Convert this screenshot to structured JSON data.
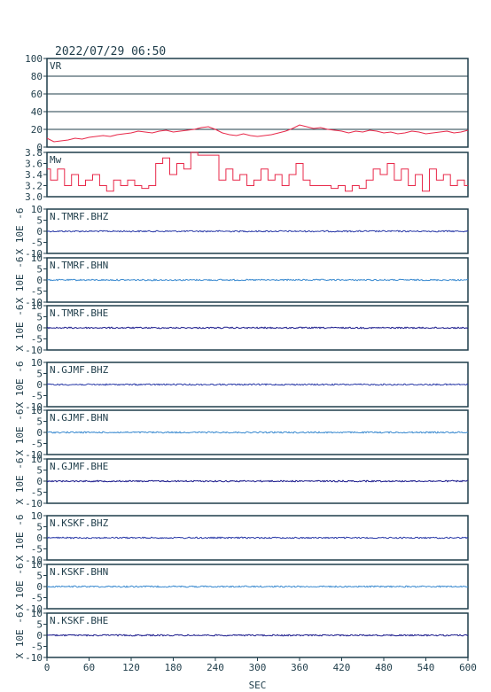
{
  "header": {
    "datetime": "2022/07/29  06:50"
  },
  "colors": {
    "vr_line": "#e8294a",
    "mw_line": "#e8294a",
    "trace_dark": "#1a1a8c",
    "trace_mid": "#2a3aa8",
    "trace_light": "#3a8ad0",
    "frame": "#1f3d4a",
    "grid": "#1f3d4a"
  },
  "chart_data": [
    {
      "type": "line",
      "label": "VR",
      "ylim": [
        0,
        100
      ],
      "yticks": [
        "100",
        "80",
        "60",
        "40",
        "20",
        "0"
      ],
      "grid": true,
      "x": [
        0,
        10,
        20,
        30,
        40,
        50,
        60,
        70,
        80,
        90,
        100,
        110,
        120,
        130,
        140,
        150,
        160,
        170,
        180,
        190,
        200,
        210,
        220,
        230,
        240,
        250,
        260,
        270,
        280,
        290,
        300,
        310,
        320,
        330,
        340,
        350,
        360,
        370,
        380,
        390,
        400,
        410,
        420,
        430,
        440,
        450,
        460,
        470,
        480,
        490,
        500,
        510,
        520,
        530,
        540,
        550,
        560,
        570,
        580,
        590,
        600
      ],
      "y": [
        10,
        6,
        7,
        8,
        10,
        9,
        11,
        12,
        13,
        12,
        14,
        15,
        16,
        18,
        17,
        16,
        18,
        19,
        17,
        18,
        19,
        20,
        22,
        23,
        20,
        16,
        14,
        13,
        15,
        13,
        12,
        13,
        14,
        16,
        18,
        21,
        25,
        23,
        21,
        22,
        20,
        19,
        18,
        16,
        18,
        17,
        19,
        18,
        16,
        17,
        15,
        16,
        18,
        17,
        15,
        16,
        17,
        18,
        16,
        17,
        19
      ]
    },
    {
      "type": "line",
      "label": "Mw",
      "ylim": [
        3.0,
        3.8
      ],
      "yticks": [
        "3.8",
        "3.6",
        "3.4",
        "3.2",
        "3.0"
      ],
      "x": [
        0,
        10,
        20,
        30,
        40,
        50,
        60,
        70,
        80,
        90,
        100,
        110,
        120,
        130,
        140,
        150,
        160,
        170,
        180,
        190,
        200,
        210,
        220,
        230,
        240,
        250,
        260,
        270,
        280,
        290,
        300,
        310,
        320,
        330,
        340,
        350,
        360,
        370,
        380,
        390,
        400,
        410,
        420,
        430,
        440,
        450,
        460,
        470,
        480,
        490,
        500,
        510,
        520,
        530,
        540,
        550,
        560,
        570,
        580,
        590,
        600
      ],
      "y": [
        3.5,
        3.3,
        3.5,
        3.2,
        3.4,
        3.2,
        3.3,
        3.4,
        3.2,
        3.1,
        3.3,
        3.2,
        3.3,
        3.2,
        3.15,
        3.2,
        3.6,
        3.7,
        3.4,
        3.6,
        3.5,
        3.8,
        3.75,
        3.75,
        3.75,
        3.3,
        3.5,
        3.3,
        3.4,
        3.2,
        3.3,
        3.5,
        3.3,
        3.4,
        3.2,
        3.4,
        3.6,
        3.3,
        3.2,
        3.2,
        3.2,
        3.15,
        3.2,
        3.1,
        3.2,
        3.15,
        3.3,
        3.5,
        3.4,
        3.6,
        3.3,
        3.5,
        3.2,
        3.4,
        3.1,
        3.5,
        3.3,
        3.4,
        3.2,
        3.3,
        3.2
      ]
    },
    {
      "type": "line",
      "label": "N.TMRF.BHZ",
      "ylim": [
        -10,
        10
      ],
      "yticks": [
        "10",
        "5",
        "0",
        "-5",
        "-10"
      ],
      "ylabel": "X 10E -6",
      "color": "trace_mid",
      "x": [
        0,
        600
      ],
      "y": [
        0,
        0
      ]
    },
    {
      "type": "line",
      "label": "N.TMRF.BHN",
      "ylim": [
        -10,
        10
      ],
      "yticks": [
        "10",
        "5",
        "0",
        "-5",
        "-10"
      ],
      "ylabel": "X 10E -6",
      "color": "trace_light",
      "x": [
        0,
        600
      ],
      "y": [
        0,
        0
      ]
    },
    {
      "type": "line",
      "label": "N.TMRF.BHE",
      "ylim": [
        -10,
        10
      ],
      "yticks": [
        "10",
        "5",
        "0",
        "-5",
        "-10"
      ],
      "ylabel": "X 10E -6",
      "color": "trace_dark",
      "x": [
        0,
        600
      ],
      "y": [
        0,
        0
      ]
    },
    {
      "type": "line",
      "label": "N.GJMF.BHZ",
      "ylim": [
        -10,
        10
      ],
      "yticks": [
        "10",
        "5",
        "0",
        "-5",
        "-10"
      ],
      "ylabel": "X 10E -6",
      "color": "trace_mid",
      "x": [
        0,
        600
      ],
      "y": [
        0,
        0
      ]
    },
    {
      "type": "line",
      "label": "N.GJMF.BHN",
      "ylim": [
        -10,
        10
      ],
      "yticks": [
        "10",
        "5",
        "0",
        "-5",
        "-10"
      ],
      "ylabel": "X 10E -6",
      "color": "trace_light",
      "x": [
        0,
        600
      ],
      "y": [
        0,
        0
      ]
    },
    {
      "type": "line",
      "label": "N.GJMF.BHE",
      "ylim": [
        -10,
        10
      ],
      "yticks": [
        "10",
        "5",
        "0",
        "-5",
        "-10"
      ],
      "ylabel": "X 10E -6",
      "color": "trace_dark",
      "x": [
        0,
        600
      ],
      "y": [
        0,
        0
      ]
    },
    {
      "type": "line",
      "label": "N.KSKF.BHZ",
      "ylim": [
        -10,
        10
      ],
      "yticks": [
        "10",
        "5",
        "0",
        "-5",
        "-10"
      ],
      "ylabel": "X 10E -6",
      "color": "trace_mid",
      "x": [
        0,
        600
      ],
      "y": [
        0,
        0
      ]
    },
    {
      "type": "line",
      "label": "N.KSKF.BHN",
      "ylim": [
        -10,
        10
      ],
      "yticks": [
        "10",
        "5",
        "0",
        "-5",
        "-10"
      ],
      "ylabel": "X 10E -6",
      "color": "trace_light",
      "x": [
        0,
        600
      ],
      "y": [
        0,
        0
      ]
    },
    {
      "type": "line",
      "label": "N.KSKF.BHE",
      "ylim": [
        -10,
        10
      ],
      "yticks": [
        "10",
        "5",
        "0",
        "-5",
        "-10"
      ],
      "ylabel": "X 10E -6",
      "color": "trace_dark",
      "x": [
        0,
        600
      ],
      "y": [
        0,
        0
      ]
    }
  ],
  "x_axis": {
    "label": "SEC",
    "xlim": [
      0,
      600
    ],
    "ticks": [
      "0",
      "60",
      "120",
      "180",
      "240",
      "300",
      "360",
      "420",
      "480",
      "540",
      "600"
    ]
  }
}
